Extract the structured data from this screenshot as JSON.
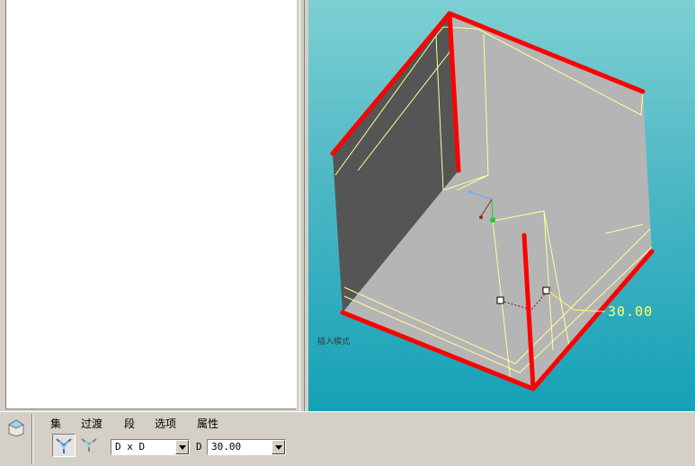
{
  "viewport": {
    "mode_label": "插入模式",
    "dimension_value": "30.00"
  },
  "dashboard": {
    "tabs": [
      "集",
      "过渡",
      "段",
      "选项",
      "属性"
    ],
    "transition_type": "D x D",
    "d_label": "D",
    "d_value": "30.00"
  },
  "colors": {
    "edge_highlight": "#ff0000",
    "preview_wire": "#ffff99",
    "viewport_top": "#7dd0d3",
    "viewport_bottom": "#15a1b6"
  }
}
